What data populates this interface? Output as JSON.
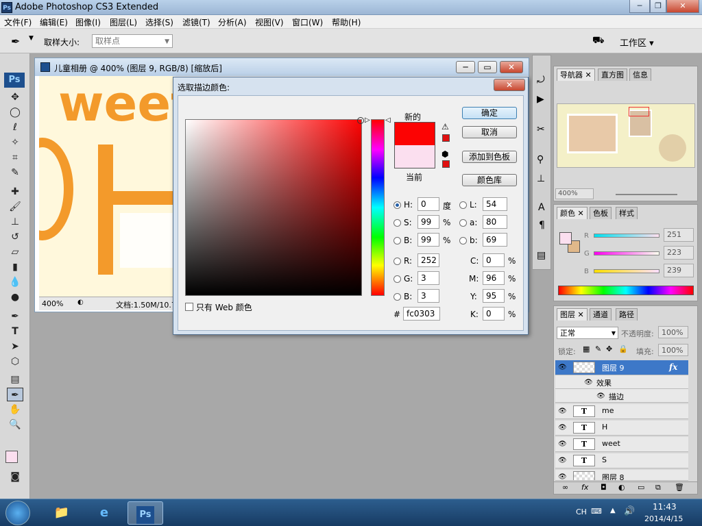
{
  "app": {
    "title": "Adobe Photoshop CS3 Extended",
    "icon": "ps-app-icon"
  },
  "menu": [
    "文件(F)",
    "编辑(E)",
    "图像(I)",
    "图层(L)",
    "选择(S)",
    "滤镜(T)",
    "分析(A)",
    "视图(V)",
    "窗口(W)",
    "帮助(H)"
  ],
  "options": {
    "sample_label": "取样大小:",
    "sample_value": "取样点",
    "workspace_label": "工作区 ▾"
  },
  "document": {
    "title": "儿童相册 @ 400% (图层 9, RGB/8) [缩放后]",
    "zoom": "400%",
    "docinfo": "文档:1.50M/10.7"
  },
  "dialog": {
    "title": "选取描边颜色:",
    "new_label": "新的",
    "current_label": "当前",
    "new_color": "#fc0303",
    "current_color": "#fbdfef",
    "ok": "确定",
    "cancel": "取消",
    "add_swatch": "添加到色板",
    "color_lib": "颜色库",
    "web_only": "只有 Web 颜色",
    "hsb": [
      {
        "label": "H:",
        "value": "0",
        "unit": "度",
        "selected": true
      },
      {
        "label": "S:",
        "value": "99",
        "unit": "%",
        "selected": false
      },
      {
        "label": "B:",
        "value": "99",
        "unit": "%",
        "selected": false
      }
    ],
    "rgb": [
      {
        "label": "R:",
        "value": "252"
      },
      {
        "label": "G:",
        "value": "3"
      },
      {
        "label": "B:",
        "value": "3"
      }
    ],
    "lab": [
      {
        "label": "L:",
        "value": "54"
      },
      {
        "label": "a:",
        "value": "80"
      },
      {
        "label": "b:",
        "value": "69"
      }
    ],
    "cmyk": [
      {
        "label": "C:",
        "value": "0",
        "unit": "%"
      },
      {
        "label": "M:",
        "value": "96",
        "unit": "%"
      },
      {
        "label": "Y:",
        "value": "95",
        "unit": "%"
      },
      {
        "label": "K:",
        "value": "0",
        "unit": "%"
      }
    ],
    "hex_label": "#",
    "hex": "fc0303"
  },
  "navigator": {
    "tabs": [
      "导航器",
      "直方图",
      "信息"
    ],
    "zoom": "400%"
  },
  "color_panel": {
    "tabs": [
      "颜色",
      "色板",
      "样式"
    ],
    "sliders": [
      {
        "label": "R",
        "value": "251"
      },
      {
        "label": "G",
        "value": "223"
      },
      {
        "label": "B",
        "value": "239"
      }
    ]
  },
  "layers_panel": {
    "tabs": [
      "图层",
      "通道",
      "路径"
    ],
    "blend": "正常",
    "opacity_label": "不透明度:",
    "opacity": "100%",
    "lock_label": "锁定:",
    "fill_label": "填充:",
    "fill": "100%",
    "effects_label": "效果",
    "stroke_label": "描边",
    "fx": "fx",
    "layers": [
      {
        "name": "图层 9",
        "type": "raster",
        "selected": true
      },
      {
        "name": "me",
        "type": "text"
      },
      {
        "name": "H",
        "type": "text"
      },
      {
        "name": "weet",
        "type": "text"
      },
      {
        "name": "S",
        "type": "text"
      },
      {
        "name": "图层 8",
        "type": "raster"
      }
    ],
    "text_thumb": "T"
  },
  "taskbar": {
    "lang": "CH",
    "time": "11:43",
    "date": "2014/4/15",
    "ps_label": "Ps"
  },
  "canvas_text": "weet"
}
